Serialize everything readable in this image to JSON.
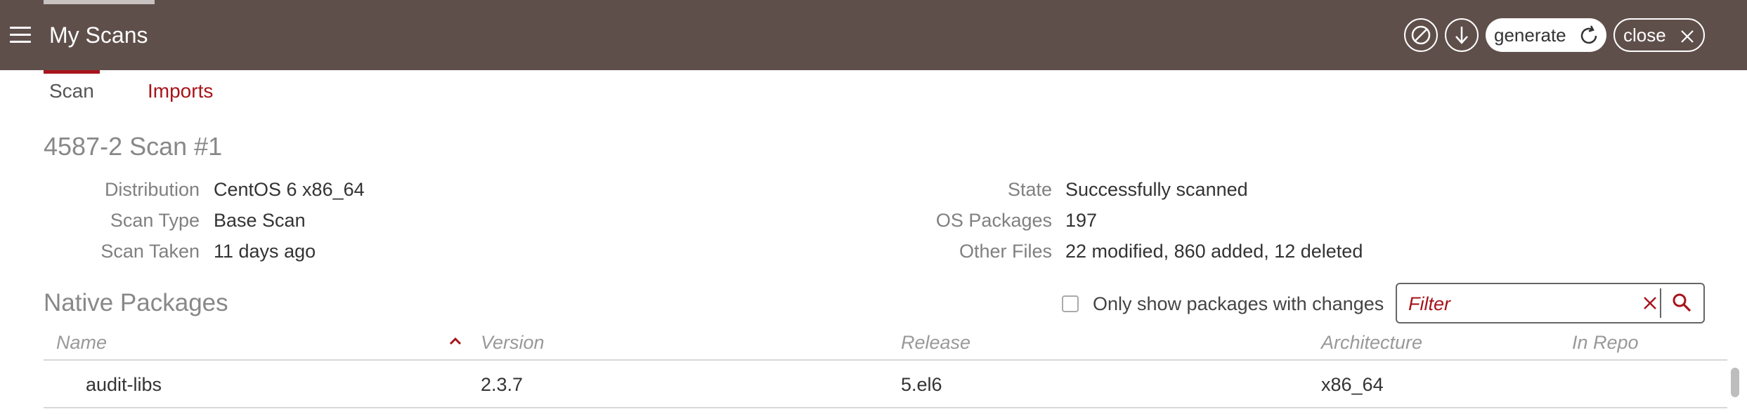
{
  "header": {
    "title": "My Scans",
    "menu_icon": "hamburger-icon",
    "buttons": {
      "cancel_icon": "cancel-circle-icon",
      "download_icon": "download-arrow-icon",
      "generate_label": "generate",
      "generate_icon": "refresh-icon",
      "close_label": "close",
      "close_icon": "close-icon"
    }
  },
  "tabs": [
    {
      "label": "Scan",
      "active": true
    },
    {
      "label": "Imports",
      "active": false
    }
  ],
  "scan": {
    "title": "4587-2 Scan #1",
    "details_left": [
      {
        "label": "Distribution",
        "value": "CentOS 6 x86_64"
      },
      {
        "label": "Scan Type",
        "value": "Base Scan"
      },
      {
        "label": "Scan Taken",
        "value": "11 days ago"
      }
    ],
    "details_right": [
      {
        "label": "State",
        "value": "Successfully scanned"
      },
      {
        "label": "OS Packages",
        "value": "197"
      },
      {
        "label": "Other Files",
        "value": "22 modified, 860 added, 12 deleted"
      }
    ]
  },
  "packages": {
    "title": "Native Packages",
    "only_changes_label": "Only show packages with changes",
    "only_changes_checked": false,
    "filter": {
      "placeholder": "Filter",
      "value": ""
    },
    "columns": [
      "Name",
      "Version",
      "Release",
      "Architecture",
      "In Repo"
    ],
    "sort": {
      "column": "Name",
      "direction": "asc"
    },
    "rows": [
      {
        "name": "audit-libs",
        "version": "2.3.7",
        "release": "5.el6",
        "architecture": "x86_64",
        "in_repo": ""
      }
    ]
  },
  "colors": {
    "header_bg": "#5f4f4a",
    "accent": "#a7141b",
    "muted_text": "#888888"
  }
}
